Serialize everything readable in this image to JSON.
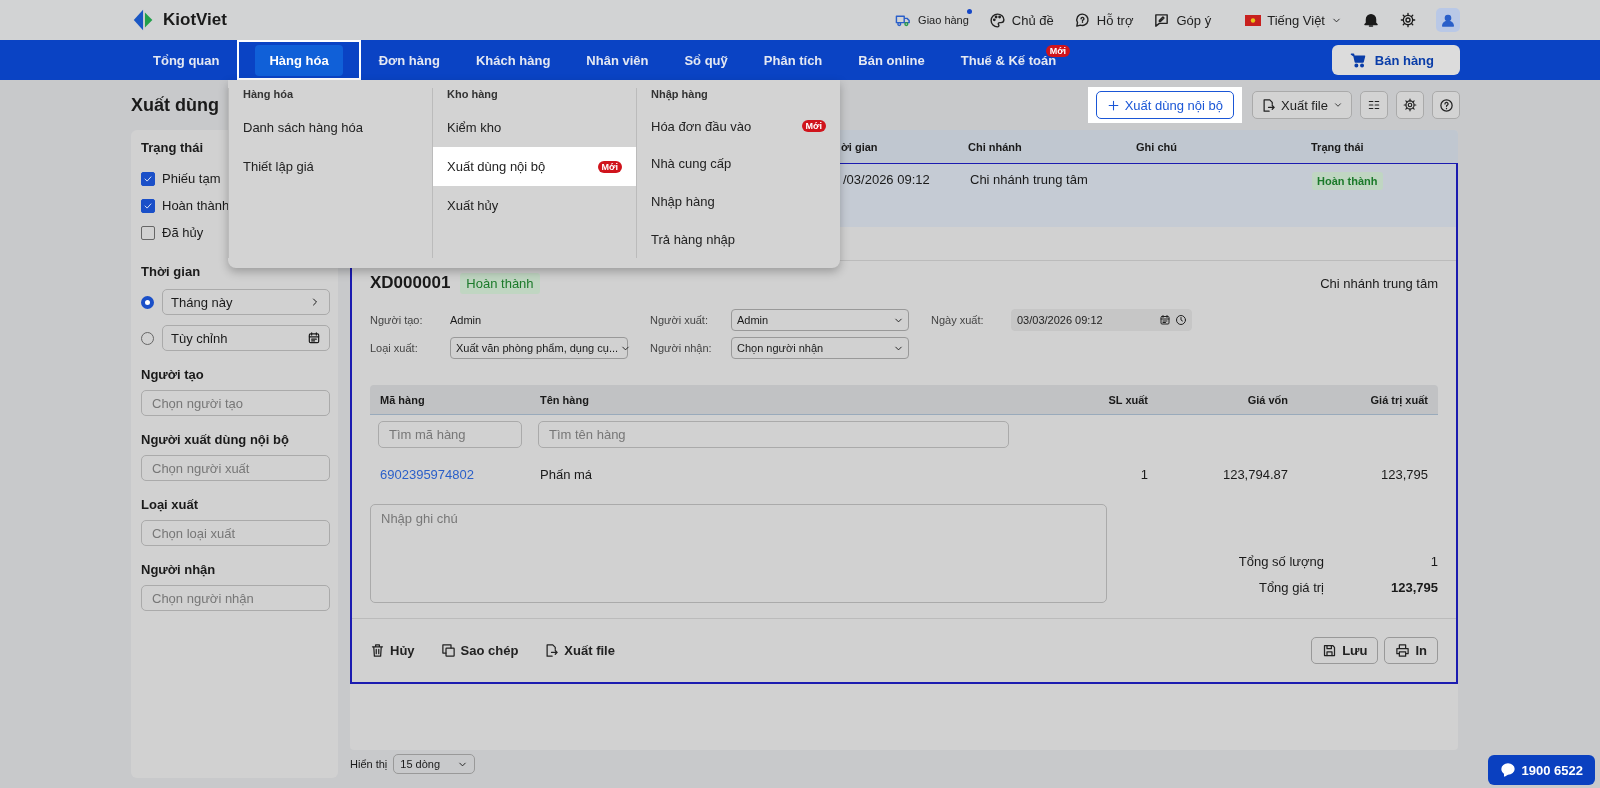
{
  "topbar": {
    "logo": "KiotViet",
    "links": [
      {
        "label": "Giao hàng",
        "kind": "delivery",
        "dot": true
      },
      {
        "label": "Chủ đề",
        "kind": "theme",
        "dot": false
      },
      {
        "label": "Hỗ trợ",
        "kind": "support",
        "dot": false
      },
      {
        "label": "Góp ý",
        "kind": "feedback",
        "dot": false
      }
    ],
    "language": "Tiếng Việt"
  },
  "nav": {
    "items": [
      {
        "label": "Tổng quan",
        "selected": false
      },
      {
        "label": "Hàng hóa",
        "selected": true
      },
      {
        "label": "Đơn hàng",
        "selected": false
      },
      {
        "label": "Khách hàng",
        "selected": false
      },
      {
        "label": "Nhân viên",
        "selected": false
      },
      {
        "label": "Sổ quỹ",
        "selected": false
      },
      {
        "label": "Phân tích",
        "selected": false
      },
      {
        "label": "Bán online",
        "selected": false
      },
      {
        "label": "Thuế & Kế toán",
        "selected": false,
        "badge": "Mới"
      }
    ],
    "sell_button": "Bán hàng"
  },
  "menu": {
    "columns": [
      {
        "heading": "Hàng hóa",
        "items": [
          {
            "label": "Danh sách hàng hóa",
            "selected": false
          },
          {
            "label": "Thiết lập giá",
            "selected": false
          }
        ]
      },
      {
        "heading": "Kho hàng",
        "items": [
          {
            "label": "Kiểm kho",
            "selected": false
          },
          {
            "label": "Xuất dùng nội bộ",
            "selected": true,
            "badge": "Mới"
          },
          {
            "label": "Xuất hủy",
            "selected": false
          }
        ]
      },
      {
        "heading": "Nhập hàng",
        "items": [
          {
            "label": "Hóa đơn đầu vào",
            "selected": false,
            "badge": "Mới"
          },
          {
            "label": "Nhà cung cấp",
            "selected": false
          },
          {
            "label": "Nhập hàng",
            "selected": false
          },
          {
            "label": "Trả hàng nhập",
            "selected": false
          }
        ]
      }
    ]
  },
  "page": {
    "title": "Xuất dùng",
    "create_button": "Xuất dùng nội bộ",
    "export_button": "Xuất file"
  },
  "filters": {
    "status": {
      "title": "Trạng thái",
      "options": [
        {
          "label": "Phiếu tạm",
          "checked": true
        },
        {
          "label": "Hoàn thành",
          "checked": true
        },
        {
          "label": "Đã hủy",
          "checked": false
        }
      ]
    },
    "time": {
      "title": "Thời gian",
      "options": [
        {
          "label": "Tháng này",
          "kind": "preset",
          "selected": true
        },
        {
          "label": "Tùy chỉnh",
          "kind": "custom",
          "selected": false
        }
      ]
    },
    "pickers": [
      {
        "title": "Người tạo",
        "placeholder": "Chọn người tạo"
      },
      {
        "title": "Người xuất dùng nội bộ",
        "placeholder": "Chọn người xuất"
      },
      {
        "title": "Loại xuất",
        "placeholder": "Chọn loại xuất"
      },
      {
        "title": "Người nhận",
        "placeholder": "Chọn người nhận"
      }
    ]
  },
  "table": {
    "columns": [
      "ời gian",
      "Chi nhánh",
      "Ghi chú",
      "Trạng thái"
    ],
    "rows": [
      {
        "time": "/03/2026 09:12",
        "branch": "Chi nhánh trung tâm",
        "status": "Hoàn thành",
        "selected": true
      }
    ]
  },
  "detail": {
    "code": "XD000001",
    "status": "Hoàn thành",
    "branch": "Chi nhánh trung tâm",
    "fields": [
      {
        "label": "Người tạo:",
        "value": "Admin",
        "kind": "text"
      },
      {
        "label": "Người xuất:",
        "value": "Admin",
        "kind": "select"
      },
      {
        "label": "Ngày xuất:",
        "value": "03/03/2026 09:12",
        "kind": "datetime"
      },
      {
        "label": "Loại xuất:",
        "value": "Xuất văn phòng phẩm, dụng cụ...",
        "kind": "select"
      },
      {
        "label": "Người nhận:",
        "value": "Chọn người nhận",
        "kind": "select"
      }
    ],
    "items": {
      "columns": [
        "Mã hàng",
        "Tên hàng",
        "SL xuất",
        "Giá vốn",
        "Giá trị xuất"
      ],
      "search_placeholders": [
        "Tìm mã hàng",
        "Tìm tên hàng"
      ],
      "rows": [
        {
          "code": "6902395974802",
          "name": "Phấn má",
          "qty": "1",
          "cost": "123,794.87",
          "value": "123,795"
        }
      ]
    },
    "note_placeholder": "Nhập ghi chú",
    "totals": [
      {
        "label": "Tổng số lượng",
        "value": "1",
        "kind": "count"
      },
      {
        "label": "Tổng giá trị",
        "value": "123,795",
        "kind": "grand"
      }
    ],
    "actions": [
      {
        "label": "Hủy",
        "kind": "delete"
      },
      {
        "label": "Sao chép",
        "kind": "copy"
      },
      {
        "label": "Xuất file",
        "kind": "export"
      }
    ],
    "buttons": [
      {
        "label": "Lưu",
        "kind": "save"
      },
      {
        "label": "In",
        "kind": "print"
      }
    ]
  },
  "pager": {
    "label": "Hiển thị",
    "value": "15 dòng"
  },
  "hotline": "1900 6522"
}
